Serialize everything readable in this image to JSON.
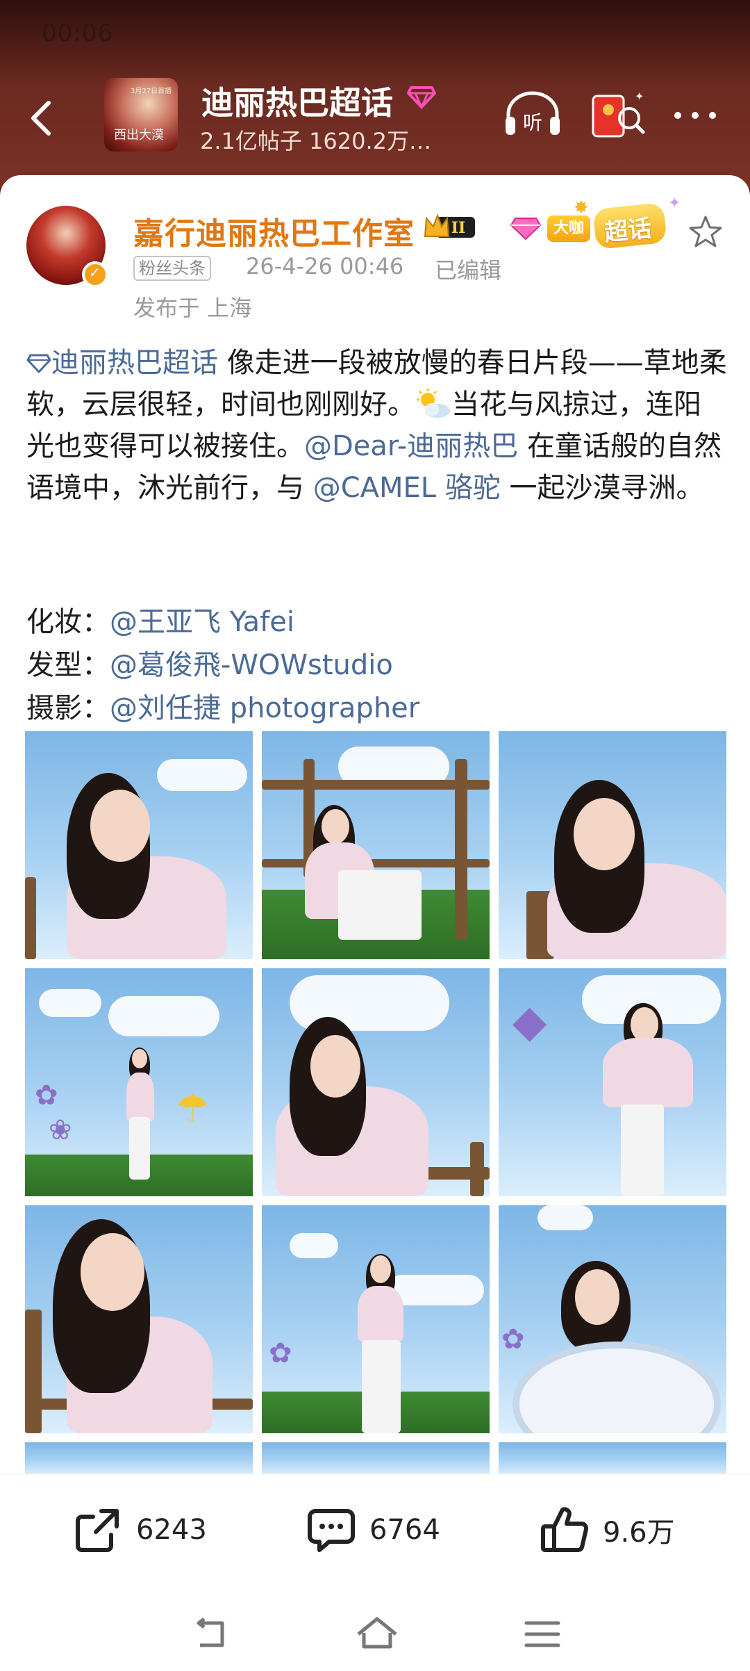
{
  "status": {
    "time": "00:06"
  },
  "header": {
    "title": "迪丽热巴超话",
    "stats": "2.1亿帖子 1620.2万…",
    "listen_label": "听",
    "poster_text": "西出大漠",
    "poster_date": "3月27日首播"
  },
  "post": {
    "author": "嘉行迪丽热巴工作室",
    "crown_level": "II",
    "daka_label": "大咖",
    "chaohua_label": "超话",
    "fan_tag": "粉丝头条",
    "time": "26-4-26 00:46",
    "edited": "已编辑",
    "location": "发布于 上海",
    "topic_link": "迪丽热巴超话",
    "text1": "  像走进一段被放慢的春日片段——草地柔软，云层很轻，时间也刚刚好。",
    "text2": "当花与风掠过，连阳光也变得可以被接住。",
    "mention1": "@Dear-迪丽热巴",
    "text3": " 在童话般的自然语境中，沐光前行，与 ",
    "mention2": "@CAMEL 骆驼",
    "text4": " 一起沙漠寻洲。",
    "credits": [
      {
        "label": "化妆：",
        "name": "@王亚飞 Yafei"
      },
      {
        "label": "发型：",
        "name": "@葛俊飛-WOWstudio"
      },
      {
        "label": "摄影：",
        "name": "@刘任捷 photographer"
      }
    ]
  },
  "actions": {
    "share_count": "6243",
    "comment_count": "6764",
    "like_count": "9.6万"
  },
  "colors": {
    "author": "#e1770e",
    "link": "#4b6a97",
    "header_bg": "#6b2a21"
  },
  "icons": [
    "back-icon",
    "gem-icon",
    "listen-icon",
    "redpacket-icon",
    "more-icon",
    "star-icon",
    "share-icon",
    "comment-icon",
    "like-icon",
    "nav-back-icon",
    "nav-home-icon",
    "nav-menu-icon"
  ]
}
